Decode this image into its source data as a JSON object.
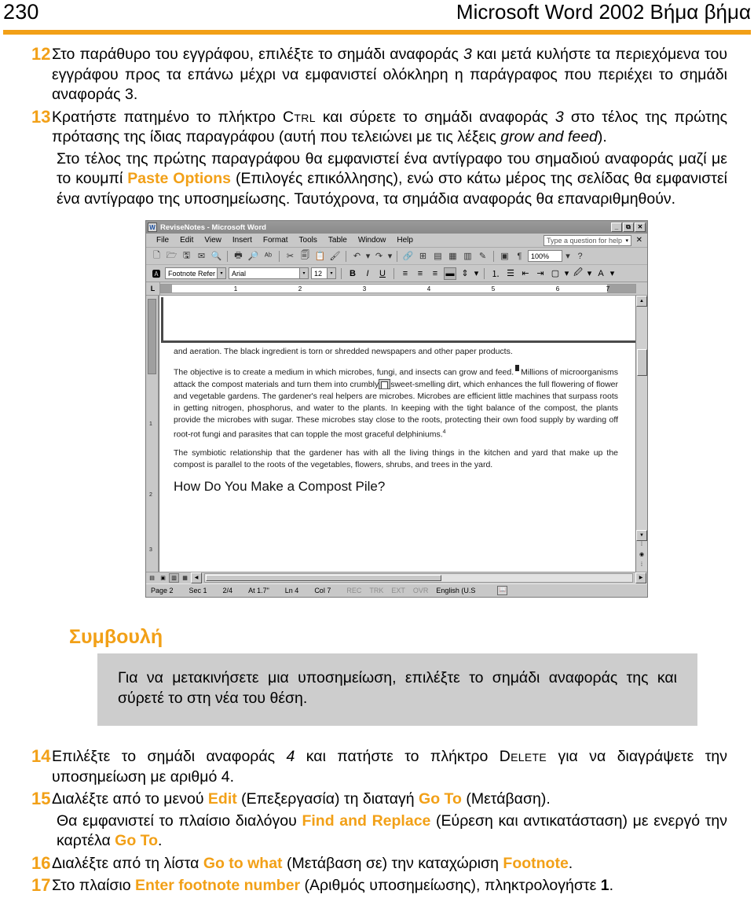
{
  "running_head": {
    "folio": "230",
    "book_title": "Microsoft Word 2002 Βήμα βήμα",
    "rule_color": "#F2A017"
  },
  "accent_color": "#F2A017",
  "steps_top": [
    {
      "number": "12",
      "text_parts": [
        {
          "t": "Στο παράθυρο του εγγράφου, επιλέξτε το σημάδι αναφοράς ",
          "s": "plain"
        },
        {
          "t": "3",
          "s": "italic"
        },
        {
          "t": " και μετά κυλήστε τα περιεχόμενα του εγγράφου προς τα επάνω μέχρι να εμφανιστεί ολόκληρη η παράγραφος που περιέχει το σημάδι αναφοράς 3.",
          "s": "plain"
        }
      ]
    },
    {
      "number": "13",
      "text_parts": [
        {
          "t": "Κρατήστε πατημένο το πλήκτρο ",
          "s": "plain"
        },
        {
          "t": "Ctrl",
          "s": "smallcaps"
        },
        {
          "t": " και σύρετε το σημάδι αναφοράς ",
          "s": "plain"
        },
        {
          "t": "3",
          "s": "italic"
        },
        {
          "t": " στο τέλος της πρώτης πρότασης της ίδιας παραγράφου (αυτή που τελειώνει με τις λέξεις ",
          "s": "plain"
        },
        {
          "t": "grow and feed",
          "s": "italic"
        },
        {
          "t": ").",
          "s": "plain"
        }
      ]
    }
  ],
  "continuation_paragraph": [
    {
      "t": "Στο τέλος της πρώτης παραγράφου θα εμφανιστεί ένα αντίγραφο του σημαδιού αναφοράς μαζί με το κουμπί ",
      "s": "plain"
    },
    {
      "t": "Paste Options",
      "s": "uiterm"
    },
    {
      "t": " (Επιλογές επικόλλησης), ενώ στο κάτω μέρος της σελίδας θα εμφανιστεί ένα αντίγραφο της υποσημείωσης. Ταυτόχρονα, τα σημάδια αναφοράς θα επαναριθμηθούν.",
      "s": "plain"
    }
  ],
  "word_window": {
    "title": "ReviseNotes - Microsoft Word",
    "title_icon": "word-document-icon",
    "window_buttons": [
      "_",
      "⧉",
      "✕"
    ],
    "menus": [
      "File",
      "Edit",
      "View",
      "Insert",
      "Format",
      "Tools",
      "Table",
      "Window",
      "Help"
    ],
    "ask_a_question": {
      "placeholder": "Type a question for help",
      "dropdown_glyph": "▾",
      "close_glyph": "✕"
    },
    "standard_toolbar": {
      "icons": [
        "new-document-icon",
        "open-icon",
        "save-icon",
        "email-icon",
        "search-icon",
        "print-icon",
        "print-preview-icon",
        "spelling-icon",
        "cut-icon",
        "copy-icon",
        "paste-icon",
        "format-painter-icon",
        "undo-icon",
        "redo-icon",
        "hyperlink-icon",
        "tables-and-borders-icon",
        "insert-table-icon",
        "insert-excel-sheet-icon",
        "columns-icon",
        "drawing-icon",
        "document-map-icon",
        "show-formatting-icon"
      ],
      "zoom": "100%",
      "help_glyph": "?"
    },
    "formatting_toolbar": {
      "style": "Footnote Refer",
      "font": "Arial",
      "size": "12",
      "bold": "B",
      "italic": "I",
      "underline": "U",
      "align_icons": [
        "align-left-icon",
        "align-center-icon",
        "align-right-icon",
        "justify-icon"
      ],
      "active_align": "justify-icon",
      "line_spacing_icon": "line-spacing-icon",
      "numbering_icon": "numbered-list-icon",
      "bullets_icon": "bulleted-list-icon",
      "decrease_indent_icon": "decrease-indent-icon",
      "increase_indent_icon": "increase-indent-icon",
      "borders_icon": "borders-icon",
      "highlight_icon": "highlight-icon",
      "font_color_icon": "font-color-icon"
    },
    "ruler": {
      "tab_selector": "L",
      "numbers": [
        "1",
        "2",
        "3",
        "4",
        "5",
        "6",
        "7"
      ]
    },
    "vertical_ruler_numbers": [
      "1",
      "2",
      "3"
    ],
    "document": {
      "paragraphs": [
        "and aeration. The black ingredient is torn or shredded newspapers and other paper products.",
        "The objective is to create a medium in which microbes, fungi, and insects can grow and feed. Millions of microorganisms attack the compost materials and turn them into crumbly sweet-smelling dirt, which enhances the full flowering of flower and vegetable gardens. The gardener's real helpers are microbes. Microbes are efficient little machines that surpass roots in getting nitrogen, phosphorus, and water to the plants. In keeping with the tight balance of the compost, the plants provide the microbes with sugar. These microbes stay close to the roots, protecting their own food supply by warding off root-rot fungi and parasites that can topple the most graceful delphiniums.",
        "The symbiotic relationship that the gardener has with all the living things in the kitchen and yard that make up the compost is parallel to the roots of the vegetables, flowers, shrubs, and trees in the yard."
      ],
      "footnote_superscript": "4",
      "heading": "How Do You Make a Compost Pile?",
      "paste_options_button": "paste-options-icon"
    },
    "view_buttons": [
      "normal-view-icon",
      "web-layout-view-icon",
      "print-layout-view-icon",
      "outline-view-icon"
    ],
    "active_view": "print-layout-view-icon",
    "status_bar": {
      "page": "Page 2",
      "section": "Sec 1",
      "pages": "2/4",
      "at": "At 1.7\"",
      "line": "Ln 4",
      "column": "Col 7",
      "modes": [
        "REC",
        "TRK",
        "EXT",
        "OVR"
      ],
      "language": "English (U.S",
      "spelling_icon": "spelling-status-icon"
    }
  },
  "tip": {
    "title": "Συμβουλή",
    "body": "Για να μετακινήσετε μια υποσημείωση, επιλέξτε το σημάδι αναφοράς της και σύρετέ το στη νέα του θέση."
  },
  "steps_bottom": [
    {
      "number": "14",
      "text_parts": [
        {
          "t": "Επιλέξτε το σημάδι αναφοράς ",
          "s": "plain"
        },
        {
          "t": "4",
          "s": "italic"
        },
        {
          "t": " και πατήστε το πλήκτρο ",
          "s": "plain"
        },
        {
          "t": "Delete",
          "s": "smallcaps"
        },
        {
          "t": " για να διαγράψετε την υποσημείωση με αριθμό 4.",
          "s": "plain"
        }
      ]
    },
    {
      "number": "15",
      "text_parts": [
        {
          "t": "Διαλέξτε από το μενού ",
          "s": "plain"
        },
        {
          "t": "Edit",
          "s": "uiterm"
        },
        {
          "t": " (Επεξεργασία) τη διαταγή ",
          "s": "plain"
        },
        {
          "t": "Go To",
          "s": "uiterm"
        },
        {
          "t": " (Μετάβαση).",
          "s": "plain"
        }
      ]
    }
  ],
  "steps_bottom_continuation": [
    {
      "t": "Θα εμφανιστεί το πλαίσιο διαλόγου ",
      "s": "plain"
    },
    {
      "t": "Find and Replace",
      "s": "uiterm"
    },
    {
      "t": " (Εύρεση και αντικατάσταση) με ενεργό την καρτέλα ",
      "s": "plain"
    },
    {
      "t": "Go To",
      "s": "uiterm"
    },
    {
      "t": ".",
      "s": "plain"
    }
  ],
  "steps_bottom_2": [
    {
      "number": "16",
      "text_parts": [
        {
          "t": "Διαλέξτε από τη λίστα ",
          "s": "plain"
        },
        {
          "t": "Go to what",
          "s": "uiterm"
        },
        {
          "t": " (Μετάβαση σε) την καταχώριση ",
          "s": "plain"
        },
        {
          "t": "Footnote",
          "s": "uiterm"
        },
        {
          "t": ".",
          "s": "plain"
        }
      ]
    },
    {
      "number": "17",
      "text_parts": [
        {
          "t": "Στο πλαίσιο ",
          "s": "plain"
        },
        {
          "t": "Enter footnote number",
          "s": "uiterm"
        },
        {
          "t": " (Αριθμός υποσημείωσης), πληκτρολογήστε ",
          "s": "plain"
        },
        {
          "t": "1",
          "s": "bold"
        },
        {
          "t": ".",
          "s": "plain"
        }
      ]
    }
  ]
}
